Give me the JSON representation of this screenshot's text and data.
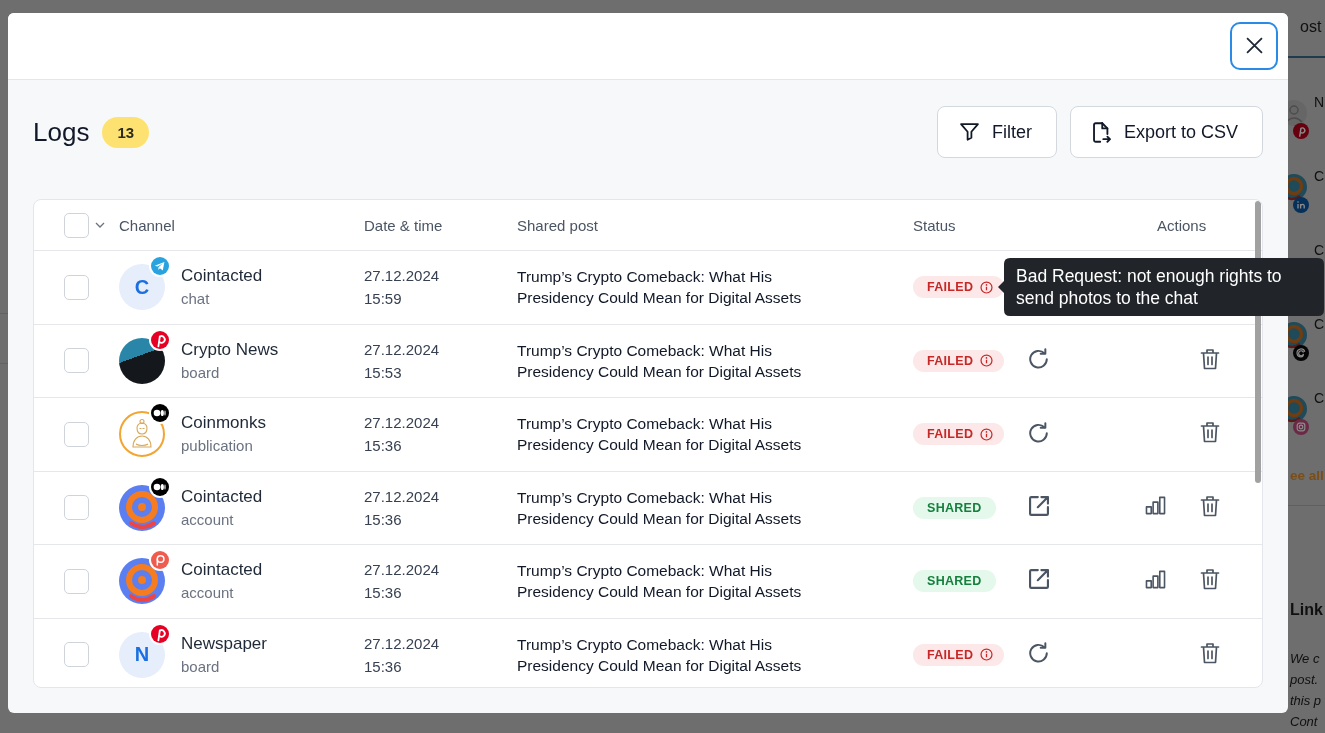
{
  "background_page": {
    "tab": "ost",
    "channels": [
      {
        "initial": "N",
        "avatar": {
          "kind": "person"
        },
        "badge": {
          "kind": "pin"
        }
      },
      {
        "initial": "C",
        "avatar": {
          "kind": "logo"
        },
        "badge": {
          "kind": "in"
        }
      },
      {
        "initial": "C"
      },
      {
        "initial": "C",
        "avatar": {
          "kind": "logo"
        },
        "badge": {
          "kind": "threads"
        }
      },
      {
        "initial": "C",
        "avatar": {
          "kind": "logo"
        },
        "badge": {
          "kind": "camera"
        }
      }
    ],
    "see_all": "ee all",
    "section_title": "Link",
    "note_lines": [
      "We c",
      "post.",
      "this p",
      "Cont"
    ]
  },
  "modal": {
    "title": "Logs",
    "count": "13",
    "toolbar": [
      {
        "kind": "filter",
        "label": "Filter"
      },
      {
        "kind": "export",
        "label": "Export to CSV"
      }
    ]
  },
  "table": {
    "select_all": {
      "checked": false
    },
    "columns": [
      "Channel",
      "Date & time",
      "Shared post",
      "Status",
      "Actions"
    ],
    "rows": [
      {
        "checked": false,
        "avatar": {
          "kind": "letter",
          "initial": "C"
        },
        "badge": {
          "kind": "plane"
        },
        "name": "Cointacted",
        "subtitle": "chat",
        "date": "27.12.2024",
        "time": "15:59",
        "post": "Trump’s Crypto Comeback: What His Presidency Could Mean for Digital Assets",
        "status": {
          "kind": "failed",
          "label": "FAILED",
          "tooltip": "Bad Request: not enough rights to send photos to the chat"
        }
      },
      {
        "checked": false,
        "avatar": {
          "kind": "photo"
        },
        "badge": {
          "kind": "pin"
        },
        "name": "Crypto News",
        "subtitle": "board",
        "date": "27.12.2024",
        "time": "15:53",
        "post": "Trump’s Crypto Comeback: What His Presidency Could Mean for Digital Assets",
        "status": {
          "kind": "failed",
          "label": "FAILED"
        },
        "actions": [
          {
            "kind": "retry"
          },
          {
            "kind": "delete"
          }
        ]
      },
      {
        "checked": false,
        "avatar": {
          "kind": "monk"
        },
        "badge": {
          "kind": "dots"
        },
        "name": "Coinmonks",
        "subtitle": "publication",
        "date": "27.12.2024",
        "time": "15:36",
        "post": "Trump’s Crypto Comeback: What His Presidency Could Mean for Digital Assets",
        "status": {
          "kind": "failed",
          "label": "FAILED"
        },
        "actions": [
          {
            "kind": "retry"
          },
          {
            "kind": "delete"
          }
        ]
      },
      {
        "checked": false,
        "avatar": {
          "kind": "logo"
        },
        "badge": {
          "kind": "dots"
        },
        "name": "Cointacted",
        "subtitle": "account",
        "date": "27.12.2024",
        "time": "15:36",
        "post": "Trump’s Crypto Comeback: What His Presidency Could Mean for Digital Assets",
        "status": {
          "kind": "shared",
          "label": "SHARED"
        },
        "actions": [
          {
            "kind": "open"
          },
          {
            "kind": "stats"
          },
          {
            "kind": "delete"
          }
        ]
      },
      {
        "checked": false,
        "avatar": {
          "kind": "logo"
        },
        "badge": {
          "kind": "p"
        },
        "name": "Cointacted",
        "subtitle": "account",
        "date": "27.12.2024",
        "time": "15:36",
        "post": "Trump’s Crypto Comeback: What His Presidency Could Mean for Digital Assets",
        "status": {
          "kind": "shared",
          "label": "SHARED"
        },
        "actions": [
          {
            "kind": "open"
          },
          {
            "kind": "stats"
          },
          {
            "kind": "delete"
          }
        ]
      },
      {
        "checked": false,
        "avatar": {
          "kind": "letter",
          "initial": "N"
        },
        "badge": {
          "kind": "pin"
        },
        "name": "Newspaper",
        "subtitle": "board",
        "date": "27.12.2024",
        "time": "15:36",
        "post": "Trump’s Crypto Comeback: What His Presidency Could Mean for Digital Assets",
        "status": {
          "kind": "failed",
          "label": "FAILED"
        },
        "actions": [
          {
            "kind": "retry"
          },
          {
            "kind": "delete"
          }
        ]
      }
    ]
  }
}
